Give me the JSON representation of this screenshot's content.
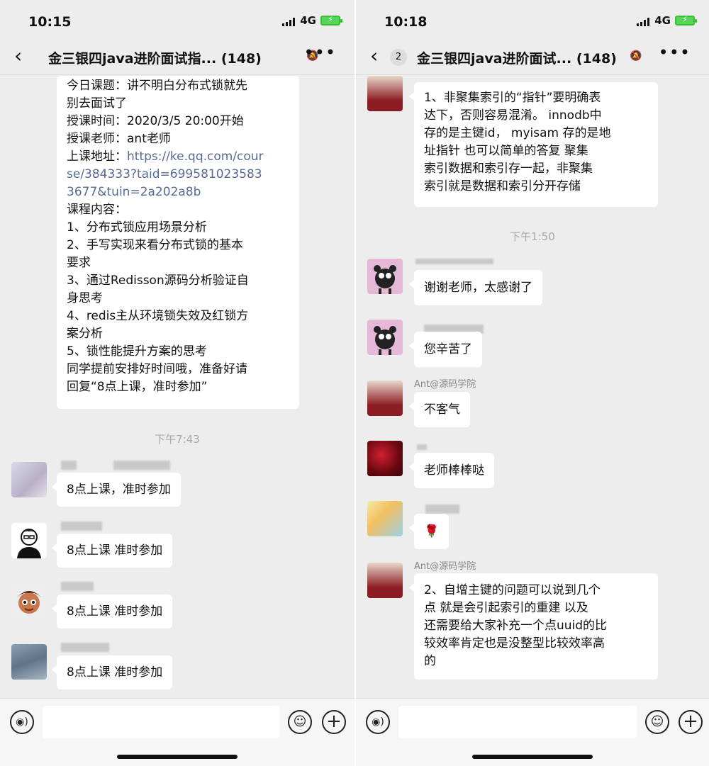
{
  "left": {
    "status": {
      "time": "10:15",
      "network": "4G"
    },
    "nav": {
      "back": "‹",
      "title": "金三银四java进阶面试指...",
      "count": "(148)"
    },
    "announcement": [
      "今日课题：讲不明白分布式锁就先",
      "别去面试了",
      "授课时间：2020/3/5 20:00开始",
      "授课老师：ant老师",
      "上课地址：https://ke.qq.com/cour",
      "se/384333?taid=69958102358​3",
      "3677&tuin=2a202a8b",
      "课程内容：",
      "1、分布式锁应用场景分析",
      "2、手写实现来看分布式锁的基本",
      "要求",
      "3、通过Redisson源码分析验证自",
      "身思考",
      "4、redis主从环境锁失效及红锁方",
      "案分析",
      "5、锁性能提升方案的思考",
      "同学提前安排好时间哦，准备好请",
      "回复“8点上课，准时参加”"
    ],
    "timestamp": "下午7:43",
    "messages": [
      {
        "text": "8点上课，准时参加"
      },
      {
        "text": "8点上课 准时参加"
      },
      {
        "text": "8点上课 准时参加"
      },
      {
        "text": "8点上课 准时参加"
      }
    ]
  },
  "right": {
    "status": {
      "time": "10:18",
      "network": "4G"
    },
    "nav": {
      "back": "‹",
      "unread": "2",
      "title": "金三银四java进阶面试...",
      "count": "(148)"
    },
    "msg1": {
      "sender": "Ant@源码学院",
      "lines": [
        "1、非聚集索引的“指针”要明确表",
        "达下，否则容易混淆。 innodb中",
        "存的是主键id， myisam 存的是地",
        "址指针  也可以简单的答复  聚集",
        "索引数据和索引存一起，非聚集",
        "索引就是数据和索引分开存储"
      ]
    },
    "timestamp": "下午1:50",
    "msg2": {
      "text": "谢谢老师，太感谢了"
    },
    "msg3": {
      "text": "您辛苦了"
    },
    "msg4": {
      "sender": "Ant@源码学院",
      "text": "不客气"
    },
    "msg5": {
      "text": "老师棒棒哒"
    },
    "msg6": {
      "text": "🌹"
    },
    "msg7": {
      "sender": "Ant@源码学院",
      "lines": [
        "2、自增主键的问题可以说到几个",
        "点 就是会引起索引的重建  以及",
        "还需要给大家补充一个点uuid的比",
        "较效率肯定也是没整型比较效率高",
        "的"
      ]
    }
  },
  "icons": {
    "voice": "voice-icon",
    "emoji": "emoji-icon",
    "plus": "plus-icon",
    "mute": "mute-icon",
    "more": "more-icon"
  },
  "colors": {
    "background": "#ededed",
    "bubble": "#ffffff",
    "link": "#576b95",
    "timestamp": "#a8a8a8",
    "battery": "#57d45a"
  }
}
